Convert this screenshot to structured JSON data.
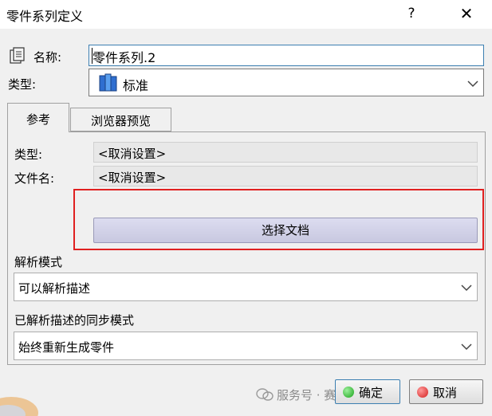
{
  "window": {
    "title": "零件系列定义",
    "help_label": "?",
    "close_label": "✕"
  },
  "form": {
    "name_label": "名称:",
    "name_value": "零件系列.2",
    "type_label": "类型:",
    "type_value": "标准"
  },
  "tabs": [
    {
      "label": "参考",
      "active": true
    },
    {
      "label": "浏览器预览",
      "active": false
    }
  ],
  "reference": {
    "type_label": "类型:",
    "type_value": "<取消设置>",
    "filename_label": "文件名:",
    "filename_value": "<取消设置>",
    "select_doc_label": "选择文档",
    "resolve_mode_label": "解析模式",
    "resolve_mode_value": "可以解析描述",
    "sync_mode_label": "已解析描述的同步模式",
    "sync_mode_value": "始终重新生成零件"
  },
  "buttons": {
    "ok_label": "确定",
    "cancel_label": "取消"
  },
  "watermark": {
    "text": "服务号 · 赛 科技"
  },
  "colors": {
    "highlight_border": "#e02020",
    "ok_dot": "#1aa31a",
    "cancel_dot": "#d42020",
    "accent": "#3c7fb1"
  }
}
